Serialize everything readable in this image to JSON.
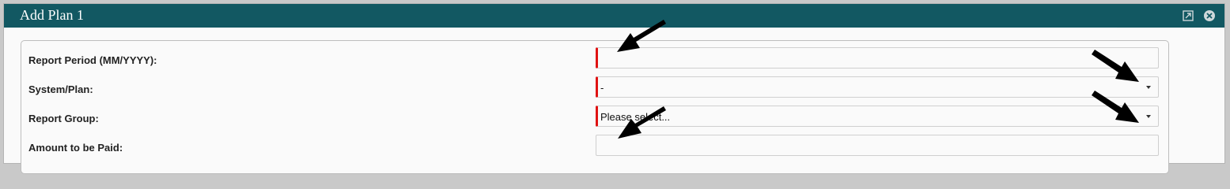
{
  "dialog": {
    "title": "Add Plan 1",
    "icons": {
      "popout": "popout-icon",
      "close": "close-icon"
    }
  },
  "form": {
    "report_period": {
      "label": "Report Period (MM/YYYY):",
      "value": ""
    },
    "system_plan": {
      "label": "System/Plan:",
      "value": "-"
    },
    "report_group": {
      "label": "Report Group:",
      "value": "Please select..."
    },
    "amount": {
      "label": "Amount to be Paid:",
      "value": ""
    }
  },
  "colors": {
    "titlebar": "#125862",
    "required_marker": "#e01212",
    "annotation_arrow": "#000000"
  }
}
